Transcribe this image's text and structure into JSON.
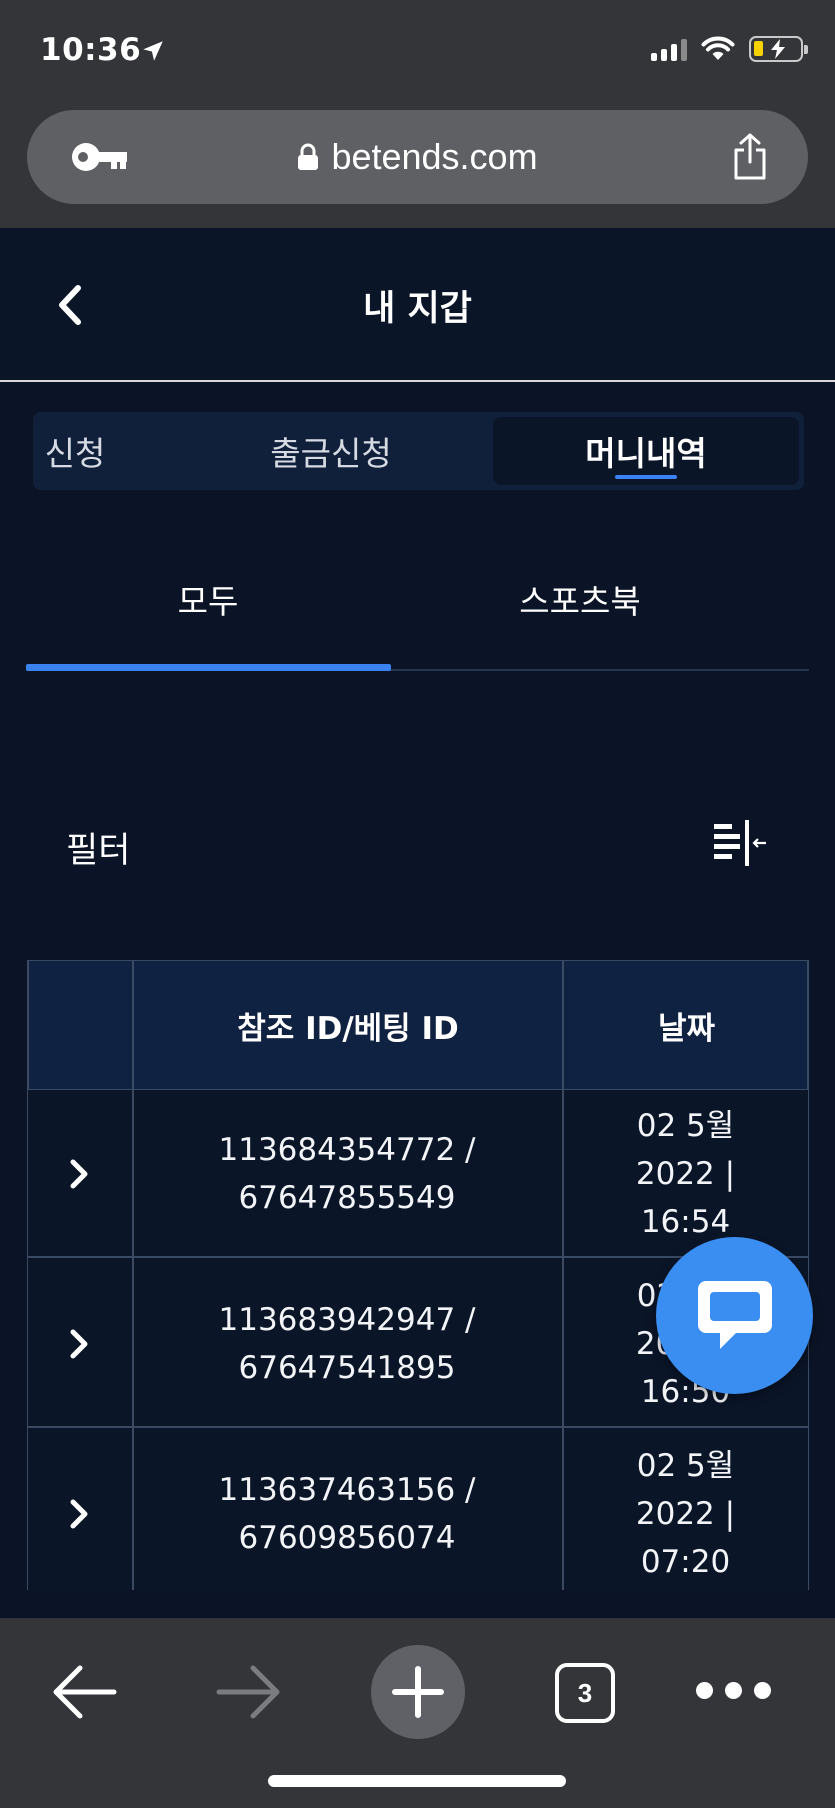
{
  "status_bar": {
    "time": "10:36"
  },
  "browser": {
    "url": "betends.com",
    "open_tabs": "3"
  },
  "header": {
    "title": "내 지갑"
  },
  "segment_tabs": [
    {
      "label": "신청"
    },
    {
      "label": "출금신청"
    },
    {
      "label": "머니내역",
      "active": true
    }
  ],
  "sub_tabs": [
    {
      "label": "모두",
      "active": true
    },
    {
      "label": "스포츠북"
    }
  ],
  "filter": {
    "label": "필터"
  },
  "table": {
    "headers": {
      "expand": "",
      "ref_id": "참조 ID/베팅 ID",
      "date": "날짜"
    },
    "rows": [
      {
        "ref_id": "113684354772 /",
        "bet_id": "67647855549",
        "date_line1": "02 5월",
        "date_line2": "2022 |",
        "date_line3": "16:54"
      },
      {
        "ref_id": "113683942947 /",
        "bet_id": "67647541895",
        "date_line1": "02 5월",
        "date_line2": "2022 |",
        "date_line3": "16:50"
      },
      {
        "ref_id": "113637463156 /",
        "bet_id": "67609856074",
        "date_line1": "02 5월",
        "date_line2": "2022 |",
        "date_line3": "07:20"
      }
    ]
  },
  "colors": {
    "background": "#0b1426",
    "accent": "#3b82f6",
    "chat_fab": "#3b8ef1",
    "browser_chrome": "#343538"
  },
  "icons": [
    "location-arrow-icon",
    "signal-icon",
    "wifi-icon",
    "battery-charging-icon",
    "key-icon",
    "lock-icon",
    "share-icon",
    "back-chevron-icon",
    "filter-collapse-icon",
    "chevron-right-icon",
    "chat-icon",
    "back-arrow-icon",
    "forward-arrow-icon",
    "plus-icon",
    "tabs-icon",
    "more-icon"
  ]
}
